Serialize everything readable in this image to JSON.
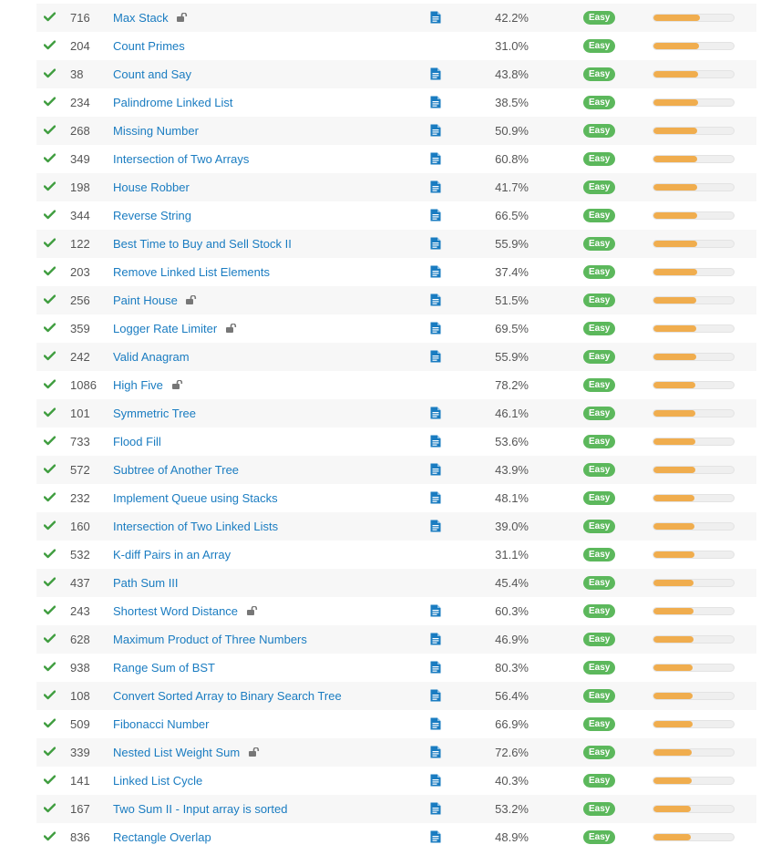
{
  "colors": {
    "link": "#1a7cc1",
    "check": "#3f9d3f",
    "easy_badge": "#5cb85c",
    "frequency_bar": "#f0ad4e",
    "row_alt": "#f7f7f7"
  },
  "icons": {
    "status": "check-icon",
    "locked": "lock-open-icon",
    "solution": "document-icon"
  },
  "problems": [
    {
      "id": "716",
      "title": "Max Stack",
      "locked": true,
      "solution": true,
      "acceptance": "42.2%",
      "difficulty": "Easy",
      "frequency": 0.58
    },
    {
      "id": "204",
      "title": "Count Primes",
      "locked": false,
      "solution": false,
      "acceptance": "31.0%",
      "difficulty": "Easy",
      "frequency": 0.57
    },
    {
      "id": "38",
      "title": "Count and Say",
      "locked": false,
      "solution": true,
      "acceptance": "43.8%",
      "difficulty": "Easy",
      "frequency": 0.56
    },
    {
      "id": "234",
      "title": "Palindrome Linked List",
      "locked": false,
      "solution": true,
      "acceptance": "38.5%",
      "difficulty": "Easy",
      "frequency": 0.56
    },
    {
      "id": "268",
      "title": "Missing Number",
      "locked": false,
      "solution": true,
      "acceptance": "50.9%",
      "difficulty": "Easy",
      "frequency": 0.55
    },
    {
      "id": "349",
      "title": "Intersection of Two Arrays",
      "locked": false,
      "solution": true,
      "acceptance": "60.8%",
      "difficulty": "Easy",
      "frequency": 0.55
    },
    {
      "id": "198",
      "title": "House Robber",
      "locked": false,
      "solution": true,
      "acceptance": "41.7%",
      "difficulty": "Easy",
      "frequency": 0.54
    },
    {
      "id": "344",
      "title": "Reverse String",
      "locked": false,
      "solution": true,
      "acceptance": "66.5%",
      "difficulty": "Easy",
      "frequency": 0.54
    },
    {
      "id": "122",
      "title": "Best Time to Buy and Sell Stock II",
      "locked": false,
      "solution": true,
      "acceptance": "55.9%",
      "difficulty": "Easy",
      "frequency": 0.54
    },
    {
      "id": "203",
      "title": "Remove Linked List Elements",
      "locked": false,
      "solution": true,
      "acceptance": "37.4%",
      "difficulty": "Easy",
      "frequency": 0.54
    },
    {
      "id": "256",
      "title": "Paint House",
      "locked": true,
      "solution": true,
      "acceptance": "51.5%",
      "difficulty": "Easy",
      "frequency": 0.53
    },
    {
      "id": "359",
      "title": "Logger Rate Limiter",
      "locked": true,
      "solution": true,
      "acceptance": "69.5%",
      "difficulty": "Easy",
      "frequency": 0.53
    },
    {
      "id": "242",
      "title": "Valid Anagram",
      "locked": false,
      "solution": true,
      "acceptance": "55.9%",
      "difficulty": "Easy",
      "frequency": 0.53
    },
    {
      "id": "1086",
      "title": "High Five",
      "locked": true,
      "solution": false,
      "acceptance": "78.2%",
      "difficulty": "Easy",
      "frequency": 0.52
    },
    {
      "id": "101",
      "title": "Symmetric Tree",
      "locked": false,
      "solution": true,
      "acceptance": "46.1%",
      "difficulty": "Easy",
      "frequency": 0.52
    },
    {
      "id": "733",
      "title": "Flood Fill",
      "locked": false,
      "solution": true,
      "acceptance": "53.6%",
      "difficulty": "Easy",
      "frequency": 0.52
    },
    {
      "id": "572",
      "title": "Subtree of Another Tree",
      "locked": false,
      "solution": true,
      "acceptance": "43.9%",
      "difficulty": "Easy",
      "frequency": 0.52
    },
    {
      "id": "232",
      "title": "Implement Queue using Stacks",
      "locked": false,
      "solution": true,
      "acceptance": "48.1%",
      "difficulty": "Easy",
      "frequency": 0.51
    },
    {
      "id": "160",
      "title": "Intersection of Two Linked Lists",
      "locked": false,
      "solution": true,
      "acceptance": "39.0%",
      "difficulty": "Easy",
      "frequency": 0.51
    },
    {
      "id": "532",
      "title": "K-diff Pairs in an Array",
      "locked": false,
      "solution": false,
      "acceptance": "31.1%",
      "difficulty": "Easy",
      "frequency": 0.51
    },
    {
      "id": "437",
      "title": "Path Sum III",
      "locked": false,
      "solution": false,
      "acceptance": "45.4%",
      "difficulty": "Easy",
      "frequency": 0.5
    },
    {
      "id": "243",
      "title": "Shortest Word Distance",
      "locked": true,
      "solution": true,
      "acceptance": "60.3%",
      "difficulty": "Easy",
      "frequency": 0.5
    },
    {
      "id": "628",
      "title": "Maximum Product of Three Numbers",
      "locked": false,
      "solution": true,
      "acceptance": "46.9%",
      "difficulty": "Easy",
      "frequency": 0.5
    },
    {
      "id": "938",
      "title": "Range Sum of BST",
      "locked": false,
      "solution": true,
      "acceptance": "80.3%",
      "difficulty": "Easy",
      "frequency": 0.49
    },
    {
      "id": "108",
      "title": "Convert Sorted Array to Binary Search Tree",
      "locked": false,
      "solution": true,
      "acceptance": "56.4%",
      "difficulty": "Easy",
      "frequency": 0.49
    },
    {
      "id": "509",
      "title": "Fibonacci Number",
      "locked": false,
      "solution": true,
      "acceptance": "66.9%",
      "difficulty": "Easy",
      "frequency": 0.49
    },
    {
      "id": "339",
      "title": "Nested List Weight Sum",
      "locked": true,
      "solution": true,
      "acceptance": "72.6%",
      "difficulty": "Easy",
      "frequency": 0.48
    },
    {
      "id": "141",
      "title": "Linked List Cycle",
      "locked": false,
      "solution": true,
      "acceptance": "40.3%",
      "difficulty": "Easy",
      "frequency": 0.48
    },
    {
      "id": "167",
      "title": "Two Sum II - Input array is sorted",
      "locked": false,
      "solution": true,
      "acceptance": "53.2%",
      "difficulty": "Easy",
      "frequency": 0.47
    },
    {
      "id": "836",
      "title": "Rectangle Overlap",
      "locked": false,
      "solution": true,
      "acceptance": "48.9%",
      "difficulty": "Easy",
      "frequency": 0.47
    }
  ]
}
